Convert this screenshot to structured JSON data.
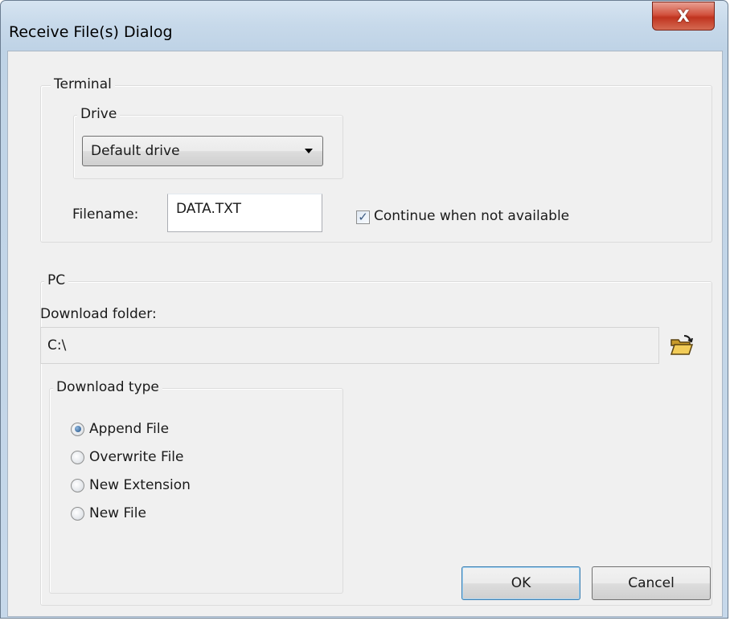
{
  "window": {
    "title": "Receive File(s) Dialog",
    "close_symbol": "X"
  },
  "terminal": {
    "group_label": "Terminal",
    "drive_group_label": "Drive",
    "drive_selected": "Default drive",
    "filename_label": "Filename:",
    "filename_value": "DATA.TXT",
    "continue_label": "Continue when not available",
    "continue_checked": true
  },
  "pc": {
    "group_label": "PC",
    "download_folder_label": "Download folder:",
    "download_folder_value": "C:\\",
    "download_type_label": "Download type",
    "options": [
      {
        "label": "Append File",
        "selected": true
      },
      {
        "label": "Overwrite File",
        "selected": false
      },
      {
        "label": "New Extension",
        "selected": false
      },
      {
        "label": "New File",
        "selected": false
      }
    ]
  },
  "buttons": {
    "ok": "OK",
    "cancel": "Cancel"
  },
  "icons": {
    "close": "close-icon",
    "browse": "folder-open-icon",
    "check": "checkmark-icon"
  },
  "colors": {
    "accent": "#3c7fb1",
    "close": "#c0341f"
  }
}
